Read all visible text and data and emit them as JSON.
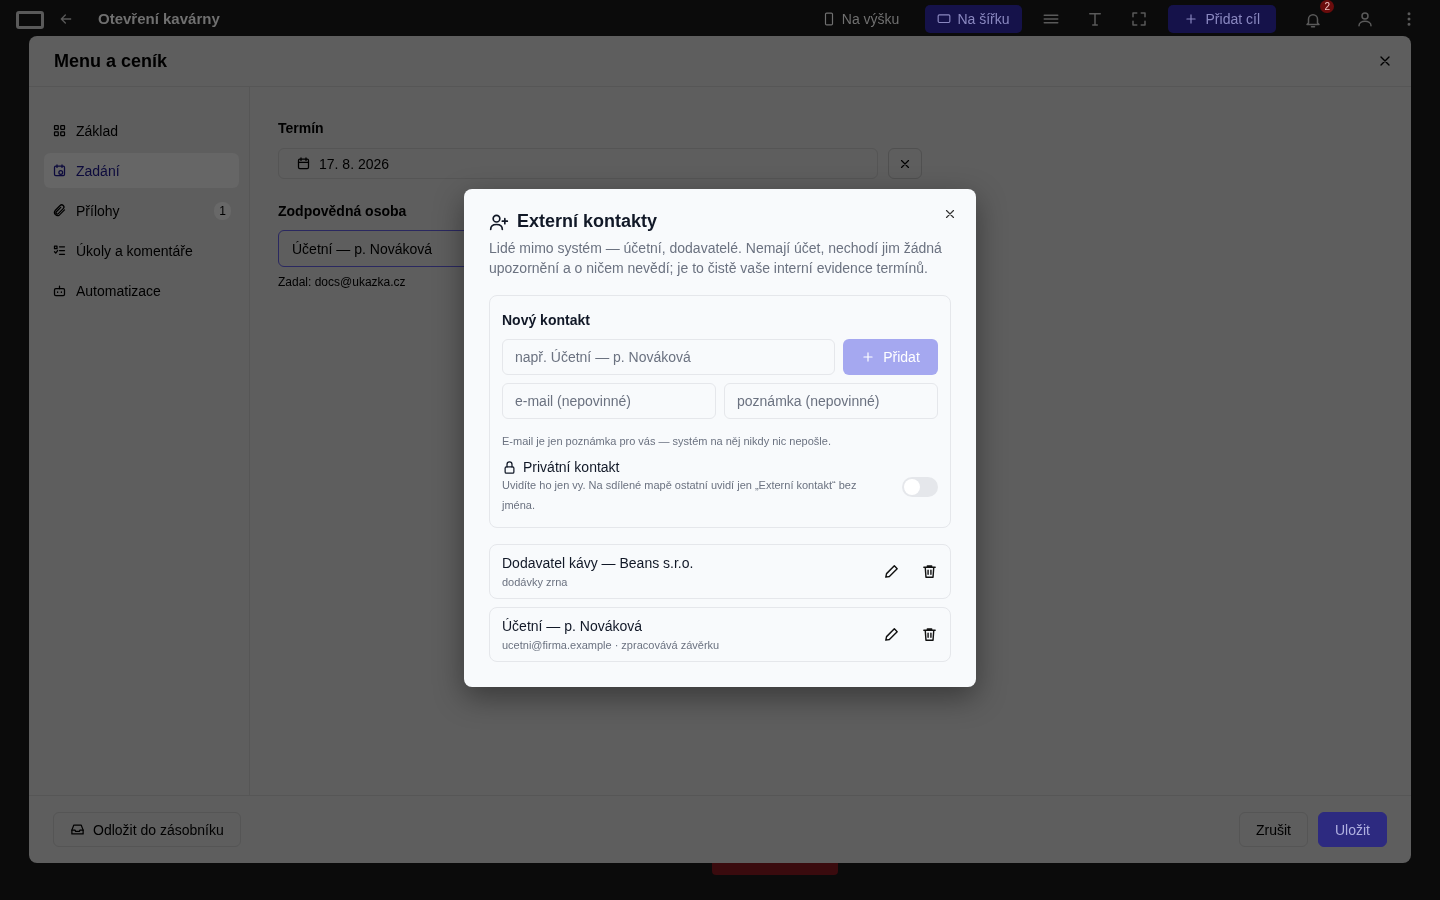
{
  "app_bar": {
    "title": "Otevření kavárny",
    "view_buttons": [
      {
        "label": "Na výšku",
        "selected": false
      },
      {
        "label": "Na šířku",
        "selected": true
      }
    ],
    "add_button": "Přidat cíl",
    "notification_count": "2"
  },
  "dialog": {
    "title": "Menu a ceník",
    "sidebar": {
      "items": [
        {
          "label": "Základ",
          "selected": false
        },
        {
          "label": "Zadání",
          "selected": true
        },
        {
          "label": "Přílohy",
          "selected": false,
          "count": "1"
        },
        {
          "label": "Úkoly a komentáře",
          "selected": false
        },
        {
          "label": "Automatizace",
          "selected": false
        }
      ]
    },
    "form": {
      "deadline_label": "Termín",
      "deadline_value": "17. 8. 2026",
      "person_label": "Zodpovědná osoba",
      "person_value": "Účetní — p. Nováková",
      "assigned_by": "Zadal: docs@ukazka.cz"
    },
    "footer": {
      "postpone_button": "Odložit do zásobníku",
      "cancel_button": "Zrušit",
      "save_button": "Uložit"
    }
  },
  "modal": {
    "title": "Externí kontakty",
    "description": "Lidé mimo systém — účetní, dodavatelé. Nemají účet, nechodí jim žádná upozornění a o ničem nevědí; je to čistě vaše interní evidence termínů.",
    "new_contact": {
      "heading": "Nový kontakt",
      "name_placeholder": "např. Účetní — p. Nováková",
      "add_button": "Přidat",
      "add_disabled": true,
      "email_placeholder": "e-mail (nepovinné)",
      "note_placeholder": "poznámka (nepovinné)",
      "hint": "E-mail je jen poznámka pro vás — systém na něj nikdy nic nepošle.",
      "private": {
        "label": "Privátní kontakt",
        "description": "Uvidíte ho jen vy. Na sdílené mapě ostatní uvidí jen „Externí kontakt“ bez jména.",
        "on": false
      }
    },
    "contacts": [
      {
        "name": "Dodavatel kávy — Beans s.r.o.",
        "detail": "dodávky zrna"
      },
      {
        "name": "Účetní — p. Nováková",
        "detail": "ucetni@firma.example · zpracovává závěrku"
      }
    ]
  }
}
